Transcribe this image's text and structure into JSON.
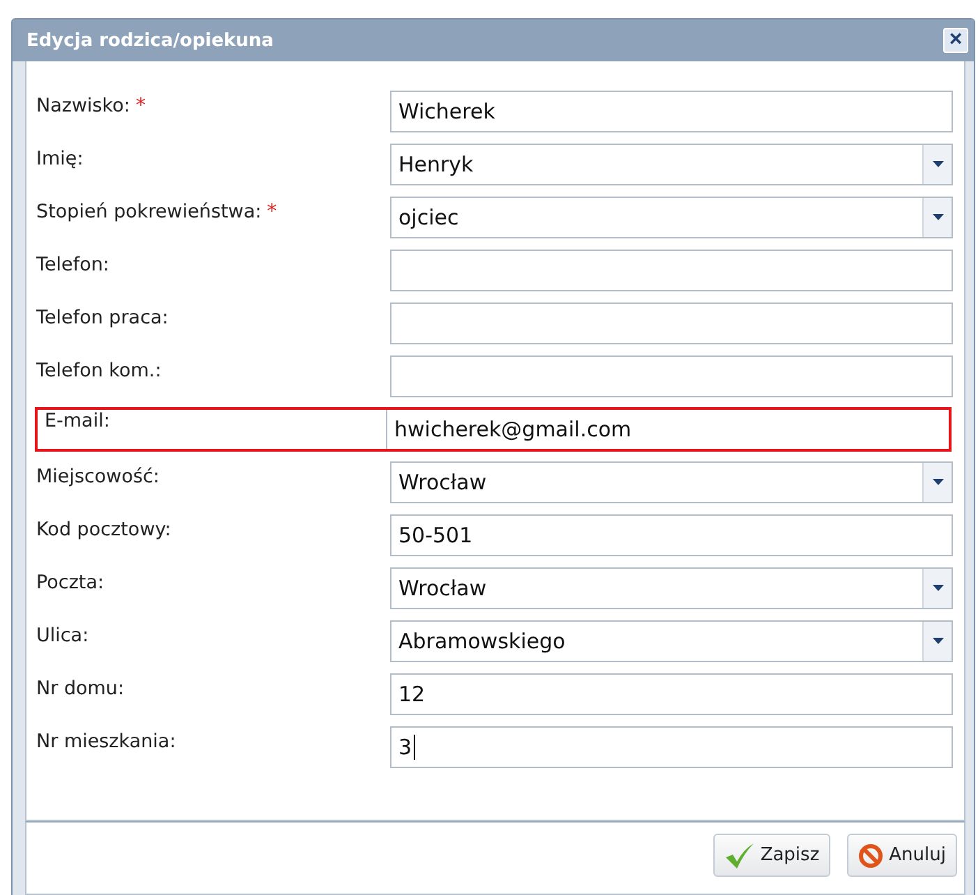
{
  "window": {
    "title": "Edycja rodzica/opiekuna",
    "close": "×"
  },
  "fields": [
    {
      "label": "Nazwisko:",
      "required_mark": "*",
      "kind": "text",
      "value": "Wicherek",
      "highlighted": false,
      "focused": false
    },
    {
      "label": "Imię:",
      "kind": "select",
      "value": "Henryk",
      "highlighted": false,
      "focused": false
    },
    {
      "label": "Stopień pokrewieństwa:",
      "required_mark": "*",
      "kind": "select",
      "value": "ojciec",
      "highlighted": false,
      "focused": false
    },
    {
      "label": "Telefon:",
      "kind": "text",
      "highlighted": false,
      "focused": false
    },
    {
      "label": "Telefon praca:",
      "kind": "text",
      "highlighted": false,
      "focused": false
    },
    {
      "label": "Telefon kom.:",
      "kind": "text",
      "highlighted": false,
      "focused": false
    },
    {
      "label": "E-mail:",
      "kind": "text",
      "value": "hwicherek@gmail.com",
      "highlighted": true,
      "focused": false
    },
    {
      "label": "Miejscowość:",
      "kind": "select",
      "value": "Wrocław",
      "highlighted": false,
      "focused": false
    },
    {
      "label": "Kod pocztowy:",
      "kind": "text",
      "value": "50-501",
      "highlighted": false,
      "focused": false
    },
    {
      "label": "Poczta:",
      "kind": "select",
      "value": "Wrocław",
      "highlighted": false,
      "focused": false
    },
    {
      "label": "Ulica:",
      "kind": "select",
      "value": "Abramowskiego",
      "highlighted": false,
      "focused": false
    },
    {
      "label": "Nr domu:",
      "kind": "text",
      "value": "12",
      "highlighted": false,
      "focused": false
    },
    {
      "label": "Nr mieszkania:",
      "kind": "text",
      "value": "3",
      "highlighted": false,
      "focused": true
    }
  ],
  "buttons": [
    {
      "label": "Zapisz",
      "kind": "save"
    },
    {
      "label": "Anuluj",
      "kind": "cancel"
    }
  ]
}
